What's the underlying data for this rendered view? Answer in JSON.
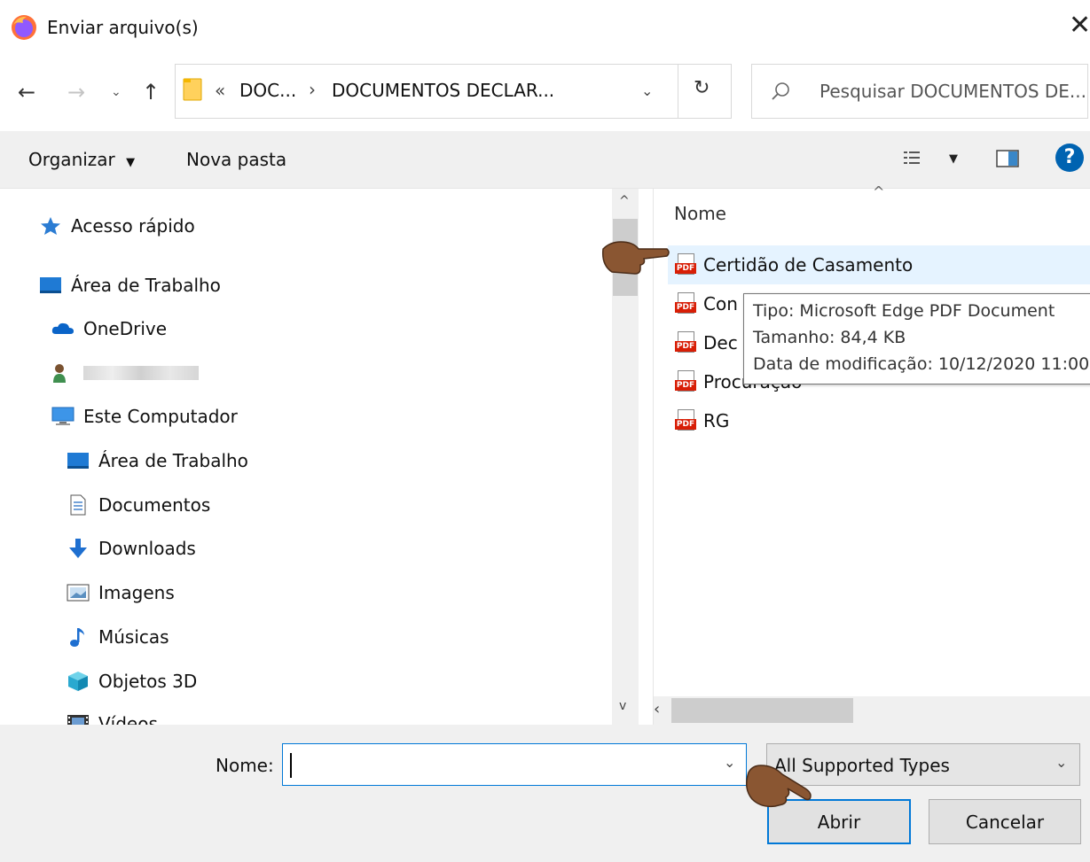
{
  "window": {
    "title": "Enviar arquivo(s)"
  },
  "address": {
    "prefix": "«",
    "crumb1": "DOC...",
    "sep": "›",
    "crumb2": "DOCUMENTOS DECLAR..."
  },
  "search": {
    "placeholder": "Pesquisar DOCUMENTOS DE..."
  },
  "toolbar": {
    "organize": "Organizar",
    "new_folder": "Nova pasta"
  },
  "sidebar": {
    "items": [
      {
        "label": "Acesso rápido",
        "icon": "star-icon"
      },
      {
        "label": "Área de Trabalho",
        "icon": "desktop-icon"
      },
      {
        "label": "OneDrive",
        "icon": "cloud-icon"
      },
      {
        "label": "",
        "icon": "user-icon"
      },
      {
        "label": "Este Computador",
        "icon": "computer-icon"
      },
      {
        "label": "Área de Trabalho",
        "icon": "desktop-icon"
      },
      {
        "label": "Documentos",
        "icon": "document-icon"
      },
      {
        "label": "Downloads",
        "icon": "download-arrow-icon"
      },
      {
        "label": "Imagens",
        "icon": "image-icon"
      },
      {
        "label": "Músicas",
        "icon": "music-note-icon"
      },
      {
        "label": "Objetos 3D",
        "icon": "cube-icon"
      },
      {
        "label": "Vídeos",
        "icon": "film-icon"
      }
    ]
  },
  "files": {
    "column_header": "Nome",
    "items": [
      {
        "name": "Certidão de Casamento"
      },
      {
        "name": "Con"
      },
      {
        "name": "Dec"
      },
      {
        "name": "Procuração"
      },
      {
        "name": "RG"
      }
    ]
  },
  "tooltip": {
    "type": "Tipo: Microsoft Edge PDF Document",
    "size": "Tamanho: 84,4 KB",
    "modified": "Data de modificação: 10/12/2020 11:00"
  },
  "footer": {
    "name_label": "Nome:",
    "name_value": "",
    "filter": "All Supported Types",
    "open_button": "Abrir",
    "cancel_button": "Cancelar"
  },
  "colors": {
    "accent": "#0078d7",
    "selection": "#e5f3ff",
    "pdf_red": "#d81e06",
    "help_blue": "#0063b1"
  }
}
